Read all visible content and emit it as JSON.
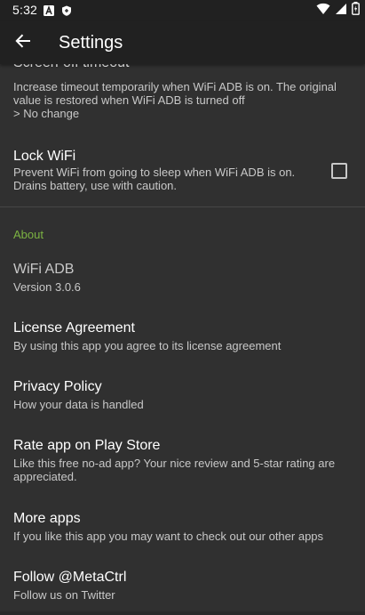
{
  "status_bar": {
    "time": "5:32",
    "icons": [
      "a-icon",
      "shield-icon",
      "wifi-icon",
      "signal-icon",
      "battery-icon"
    ]
  },
  "app_bar": {
    "title": "Settings",
    "back_icon": "arrow-back-icon"
  },
  "colors": {
    "background": "#303030",
    "bar": "#212121",
    "accent": "#7cb342",
    "summary_text": "#c8c8c8"
  },
  "preferences": [
    {
      "title": "Screen-off timeout",
      "summary_lines": [
        "Increase timeout temporarily when WiFi ADB is on. The original",
        "value is restored when WiFi ADB is turned off",
        "> No change"
      ]
    },
    {
      "title": "Lock WiFi",
      "summary_lines": [
        "Prevent WiFi from going to sleep when WiFi ADB is on.",
        "Drains battery, use with caution."
      ],
      "checked": false
    }
  ],
  "about": {
    "category": "About",
    "items": [
      {
        "title": "WiFi ADB",
        "summary_lines": [
          "Version 3.0.6"
        ]
      },
      {
        "title": "License Agreement",
        "summary_lines": [
          "By using this app you agree to its license agreement"
        ]
      },
      {
        "title": "Privacy Policy",
        "summary_lines": [
          "How your data is handled"
        ]
      },
      {
        "title": "Rate app on Play Store",
        "summary_lines": [
          "Like this free no-ad app? Your nice review and 5-star rating are",
          "appreciated."
        ]
      },
      {
        "title": "More apps",
        "summary_lines": [
          "If you like this app you may want to check out our other apps"
        ]
      },
      {
        "title": "Follow @MetaCtrl",
        "summary_lines": [
          "Follow us on Twitter"
        ]
      }
    ]
  }
}
